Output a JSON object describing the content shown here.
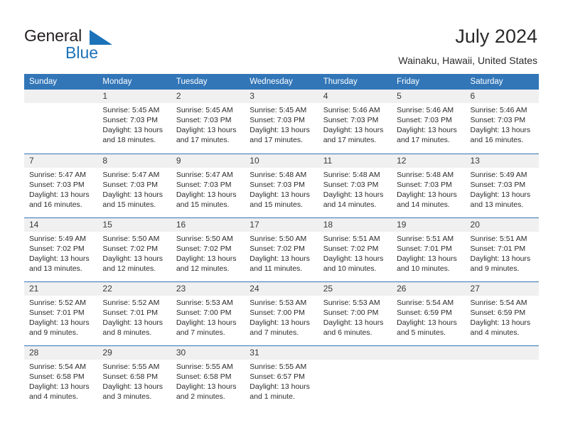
{
  "brand": {
    "name_part1": "General",
    "name_part2": "Blue",
    "triangle_color": "#1b72b8"
  },
  "header": {
    "title": "July 2024",
    "location": "Wainaku, Hawaii, United States"
  },
  "theme": {
    "header_blue": "#3276b8",
    "daynum_background": "#f0f0f0",
    "text": "#2b2b2b"
  },
  "weekdays": [
    "Sunday",
    "Monday",
    "Tuesday",
    "Wednesday",
    "Thursday",
    "Friday",
    "Saturday"
  ],
  "labels": {
    "sunrise": "Sunrise:",
    "sunset": "Sunset:",
    "daylight": "Daylight:"
  },
  "weeks": [
    [
      {
        "day": "",
        "sunrise": "",
        "sunset": "",
        "daylight_line1": "",
        "daylight_line2": ""
      },
      {
        "day": "1",
        "sunrise": "Sunrise: 5:45 AM",
        "sunset": "Sunset: 7:03 PM",
        "daylight_line1": "Daylight: 13 hours",
        "daylight_line2": "and 18 minutes."
      },
      {
        "day": "2",
        "sunrise": "Sunrise: 5:45 AM",
        "sunset": "Sunset: 7:03 PM",
        "daylight_line1": "Daylight: 13 hours",
        "daylight_line2": "and 17 minutes."
      },
      {
        "day": "3",
        "sunrise": "Sunrise: 5:45 AM",
        "sunset": "Sunset: 7:03 PM",
        "daylight_line1": "Daylight: 13 hours",
        "daylight_line2": "and 17 minutes."
      },
      {
        "day": "4",
        "sunrise": "Sunrise: 5:46 AM",
        "sunset": "Sunset: 7:03 PM",
        "daylight_line1": "Daylight: 13 hours",
        "daylight_line2": "and 17 minutes."
      },
      {
        "day": "5",
        "sunrise": "Sunrise: 5:46 AM",
        "sunset": "Sunset: 7:03 PM",
        "daylight_line1": "Daylight: 13 hours",
        "daylight_line2": "and 17 minutes."
      },
      {
        "day": "6",
        "sunrise": "Sunrise: 5:46 AM",
        "sunset": "Sunset: 7:03 PM",
        "daylight_line1": "Daylight: 13 hours",
        "daylight_line2": "and 16 minutes."
      }
    ],
    [
      {
        "day": "7",
        "sunrise": "Sunrise: 5:47 AM",
        "sunset": "Sunset: 7:03 PM",
        "daylight_line1": "Daylight: 13 hours",
        "daylight_line2": "and 16 minutes."
      },
      {
        "day": "8",
        "sunrise": "Sunrise: 5:47 AM",
        "sunset": "Sunset: 7:03 PM",
        "daylight_line1": "Daylight: 13 hours",
        "daylight_line2": "and 15 minutes."
      },
      {
        "day": "9",
        "sunrise": "Sunrise: 5:47 AM",
        "sunset": "Sunset: 7:03 PM",
        "daylight_line1": "Daylight: 13 hours",
        "daylight_line2": "and 15 minutes."
      },
      {
        "day": "10",
        "sunrise": "Sunrise: 5:48 AM",
        "sunset": "Sunset: 7:03 PM",
        "daylight_line1": "Daylight: 13 hours",
        "daylight_line2": "and 15 minutes."
      },
      {
        "day": "11",
        "sunrise": "Sunrise: 5:48 AM",
        "sunset": "Sunset: 7:03 PM",
        "daylight_line1": "Daylight: 13 hours",
        "daylight_line2": "and 14 minutes."
      },
      {
        "day": "12",
        "sunrise": "Sunrise: 5:48 AM",
        "sunset": "Sunset: 7:03 PM",
        "daylight_line1": "Daylight: 13 hours",
        "daylight_line2": "and 14 minutes."
      },
      {
        "day": "13",
        "sunrise": "Sunrise: 5:49 AM",
        "sunset": "Sunset: 7:03 PM",
        "daylight_line1": "Daylight: 13 hours",
        "daylight_line2": "and 13 minutes."
      }
    ],
    [
      {
        "day": "14",
        "sunrise": "Sunrise: 5:49 AM",
        "sunset": "Sunset: 7:02 PM",
        "daylight_line1": "Daylight: 13 hours",
        "daylight_line2": "and 13 minutes."
      },
      {
        "day": "15",
        "sunrise": "Sunrise: 5:50 AM",
        "sunset": "Sunset: 7:02 PM",
        "daylight_line1": "Daylight: 13 hours",
        "daylight_line2": "and 12 minutes."
      },
      {
        "day": "16",
        "sunrise": "Sunrise: 5:50 AM",
        "sunset": "Sunset: 7:02 PM",
        "daylight_line1": "Daylight: 13 hours",
        "daylight_line2": "and 12 minutes."
      },
      {
        "day": "17",
        "sunrise": "Sunrise: 5:50 AM",
        "sunset": "Sunset: 7:02 PM",
        "daylight_line1": "Daylight: 13 hours",
        "daylight_line2": "and 11 minutes."
      },
      {
        "day": "18",
        "sunrise": "Sunrise: 5:51 AM",
        "sunset": "Sunset: 7:02 PM",
        "daylight_line1": "Daylight: 13 hours",
        "daylight_line2": "and 10 minutes."
      },
      {
        "day": "19",
        "sunrise": "Sunrise: 5:51 AM",
        "sunset": "Sunset: 7:01 PM",
        "daylight_line1": "Daylight: 13 hours",
        "daylight_line2": "and 10 minutes."
      },
      {
        "day": "20",
        "sunrise": "Sunrise: 5:51 AM",
        "sunset": "Sunset: 7:01 PM",
        "daylight_line1": "Daylight: 13 hours",
        "daylight_line2": "and 9 minutes."
      }
    ],
    [
      {
        "day": "21",
        "sunrise": "Sunrise: 5:52 AM",
        "sunset": "Sunset: 7:01 PM",
        "daylight_line1": "Daylight: 13 hours",
        "daylight_line2": "and 9 minutes."
      },
      {
        "day": "22",
        "sunrise": "Sunrise: 5:52 AM",
        "sunset": "Sunset: 7:01 PM",
        "daylight_line1": "Daylight: 13 hours",
        "daylight_line2": "and 8 minutes."
      },
      {
        "day": "23",
        "sunrise": "Sunrise: 5:53 AM",
        "sunset": "Sunset: 7:00 PM",
        "daylight_line1": "Daylight: 13 hours",
        "daylight_line2": "and 7 minutes."
      },
      {
        "day": "24",
        "sunrise": "Sunrise: 5:53 AM",
        "sunset": "Sunset: 7:00 PM",
        "daylight_line1": "Daylight: 13 hours",
        "daylight_line2": "and 7 minutes."
      },
      {
        "day": "25",
        "sunrise": "Sunrise: 5:53 AM",
        "sunset": "Sunset: 7:00 PM",
        "daylight_line1": "Daylight: 13 hours",
        "daylight_line2": "and 6 minutes."
      },
      {
        "day": "26",
        "sunrise": "Sunrise: 5:54 AM",
        "sunset": "Sunset: 6:59 PM",
        "daylight_line1": "Daylight: 13 hours",
        "daylight_line2": "and 5 minutes."
      },
      {
        "day": "27",
        "sunrise": "Sunrise: 5:54 AM",
        "sunset": "Sunset: 6:59 PM",
        "daylight_line1": "Daylight: 13 hours",
        "daylight_line2": "and 4 minutes."
      }
    ],
    [
      {
        "day": "28",
        "sunrise": "Sunrise: 5:54 AM",
        "sunset": "Sunset: 6:58 PM",
        "daylight_line1": "Daylight: 13 hours",
        "daylight_line2": "and 4 minutes."
      },
      {
        "day": "29",
        "sunrise": "Sunrise: 5:55 AM",
        "sunset": "Sunset: 6:58 PM",
        "daylight_line1": "Daylight: 13 hours",
        "daylight_line2": "and 3 minutes."
      },
      {
        "day": "30",
        "sunrise": "Sunrise: 5:55 AM",
        "sunset": "Sunset: 6:58 PM",
        "daylight_line1": "Daylight: 13 hours",
        "daylight_line2": "and 2 minutes."
      },
      {
        "day": "31",
        "sunrise": "Sunrise: 5:55 AM",
        "sunset": "Sunset: 6:57 PM",
        "daylight_line1": "Daylight: 13 hours",
        "daylight_line2": "and 1 minute."
      },
      {
        "day": "",
        "sunrise": "",
        "sunset": "",
        "daylight_line1": "",
        "daylight_line2": ""
      },
      {
        "day": "",
        "sunrise": "",
        "sunset": "",
        "daylight_line1": "",
        "daylight_line2": ""
      },
      {
        "day": "",
        "sunrise": "",
        "sunset": "",
        "daylight_line1": "",
        "daylight_line2": ""
      }
    ]
  ]
}
